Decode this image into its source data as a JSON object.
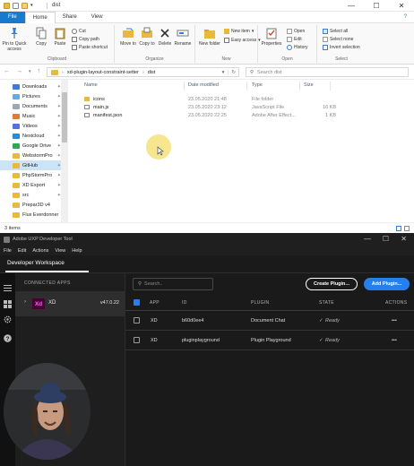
{
  "explorer": {
    "title": "dist",
    "tabs": [
      "File",
      "Home",
      "Share",
      "View"
    ],
    "ribbon": {
      "clipboard": {
        "pin_label": "Pin to Quick access",
        "copy_label": "Copy",
        "paste_label": "Paste",
        "cut_label": "Cut",
        "copy_path_label": "Copy path",
        "paste_shortcut_label": "Paste shortcut",
        "group_label": "Clipboard"
      },
      "organize": {
        "move_to_label": "Move to",
        "copy_to_label": "Copy to",
        "delete_label": "Delete",
        "rename_label": "Rename",
        "group_label": "Organize"
      },
      "new": {
        "new_folder_label": "New folder",
        "new_item_label": "New item",
        "easy_access_label": "Easy access",
        "group_label": "New"
      },
      "open": {
        "properties_label": "Properties",
        "open_label": "Open",
        "edit_label": "Edit",
        "history_label": "History",
        "group_label": "Open"
      },
      "select": {
        "select_all_label": "Select all",
        "select_none_label": "Select none",
        "invert_selection_label": "Invert selection",
        "group_label": "Select"
      }
    },
    "address": {
      "path_parts": [
        "xd-plugin-layout-constraint-setter",
        "dist"
      ],
      "search_placeholder": "Search dist"
    },
    "nav_items": [
      {
        "label": "Downloads",
        "icon": "download-icon"
      },
      {
        "label": "Pictures",
        "icon": "pictures-icon"
      },
      {
        "label": "Documents",
        "icon": "documents-icon"
      },
      {
        "label": "Music",
        "icon": "music-icon"
      },
      {
        "label": "Videos",
        "icon": "videos-icon"
      },
      {
        "label": "Nextcloud",
        "icon": "nextcloud-icon"
      },
      {
        "label": "Google Drive",
        "icon": "google-drive-icon"
      },
      {
        "label": "WebstormPro",
        "icon": "folder-icon"
      },
      {
        "label": "GitHub",
        "icon": "folder-icon"
      },
      {
        "label": "PhpStormPro",
        "icon": "folder-icon"
      },
      {
        "label": "XD Export",
        "icon": "folder-icon"
      },
      {
        "label": "src",
        "icon": "folder-icon"
      },
      {
        "label": "Prepar3D v4",
        "icon": "folder-icon"
      },
      {
        "label": "Flux Everdonner",
        "icon": "folder-icon"
      }
    ],
    "selected_nav": "GitHub",
    "columns": [
      "Name",
      "Date modified",
      "Type",
      "Size"
    ],
    "files": [
      {
        "name": "icons",
        "date": "23.05.2020 21:48",
        "type": "File folder",
        "size": ""
      },
      {
        "name": "main.js",
        "date": "23.05.2020 23:12",
        "type": "JavaScript File",
        "size": "16 KB"
      },
      {
        "name": "manifest.json",
        "date": "23.05.2020 22:25",
        "type": "Adobe After Effect...",
        "size": "1 KB"
      }
    ],
    "status": "3 items"
  },
  "uxp": {
    "window_title": "Adobe UXP Developer Tool",
    "menu": [
      "File",
      "Edit",
      "Actions",
      "View",
      "Help"
    ],
    "workspace_label": "Developer Workspace",
    "connected_apps_label": "CONNECTED APPS",
    "app": {
      "badge": "Xd",
      "name": "XD",
      "version": "v47.0.22"
    },
    "search_placeholder": "Search..",
    "create_button": "Create Plugin...",
    "add_button": "Add Plugin...",
    "columns": [
      "APP",
      "ID",
      "PLUGIN",
      "STATE",
      "ACTIONS"
    ],
    "plugins": [
      {
        "app": "XD",
        "id": "b60d0ee4",
        "plugin": "Document Chat",
        "state": "Ready",
        "actions": "•••"
      },
      {
        "app": "XD",
        "id": "pluginplayground",
        "plugin": "Plugin Playground",
        "state": "Ready",
        "actions": "•••"
      }
    ]
  },
  "colors": {
    "accent": "#2680eb",
    "file_tab": "#1979ca",
    "xd_badge_bg": "#470137",
    "xd_badge_fg": "#ff61f6",
    "cursor_highlight": "#f5e27a"
  }
}
